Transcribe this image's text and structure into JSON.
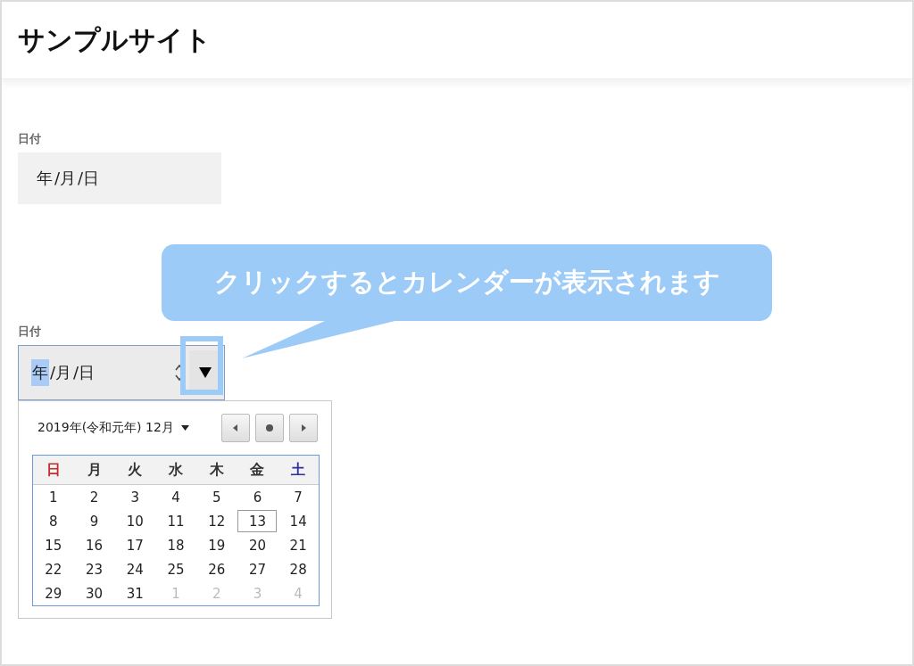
{
  "header": {
    "title": "サンプルサイト"
  },
  "fields": [
    {
      "label": "日付",
      "focused": false,
      "segments": [
        {
          "text": "年",
          "selected": false
        },
        {
          "text": "/月",
          "selected": false
        },
        {
          "text": "/日",
          "selected": false
        }
      ]
    },
    {
      "label": "日付",
      "focused": true,
      "segments": [
        {
          "text": "年",
          "selected": true
        },
        {
          "text": "/月",
          "selected": false
        },
        {
          "text": "/日",
          "selected": false
        }
      ]
    }
  ],
  "callout": {
    "text": "クリックするとカレンダーが表示されます"
  },
  "calendar": {
    "month_label": "2019年(令和元年) 12月",
    "weekdays": [
      {
        "label": "日",
        "color": "#c0302b"
      },
      {
        "label": "月",
        "color": "#333333"
      },
      {
        "label": "火",
        "color": "#333333"
      },
      {
        "label": "水",
        "color": "#333333"
      },
      {
        "label": "木",
        "color": "#333333"
      },
      {
        "label": "金",
        "color": "#333333"
      },
      {
        "label": "土",
        "color": "#2b2fa0"
      }
    ],
    "weeks": [
      [
        {
          "day": "1",
          "muted": false,
          "selected": false
        },
        {
          "day": "2",
          "muted": false,
          "selected": false
        },
        {
          "day": "3",
          "muted": false,
          "selected": false
        },
        {
          "day": "4",
          "muted": false,
          "selected": false
        },
        {
          "day": "5",
          "muted": false,
          "selected": false
        },
        {
          "day": "6",
          "muted": false,
          "selected": false
        },
        {
          "day": "7",
          "muted": false,
          "selected": false
        }
      ],
      [
        {
          "day": "8",
          "muted": false,
          "selected": false
        },
        {
          "day": "9",
          "muted": false,
          "selected": false
        },
        {
          "day": "10",
          "muted": false,
          "selected": false
        },
        {
          "day": "11",
          "muted": false,
          "selected": false
        },
        {
          "day": "12",
          "muted": false,
          "selected": false
        },
        {
          "day": "13",
          "muted": false,
          "selected": true
        },
        {
          "day": "14",
          "muted": false,
          "selected": false
        }
      ],
      [
        {
          "day": "15",
          "muted": false,
          "selected": false
        },
        {
          "day": "16",
          "muted": false,
          "selected": false
        },
        {
          "day": "17",
          "muted": false,
          "selected": false
        },
        {
          "day": "18",
          "muted": false,
          "selected": false
        },
        {
          "day": "19",
          "muted": false,
          "selected": false
        },
        {
          "day": "20",
          "muted": false,
          "selected": false
        },
        {
          "day": "21",
          "muted": false,
          "selected": false
        }
      ],
      [
        {
          "day": "22",
          "muted": false,
          "selected": false
        },
        {
          "day": "23",
          "muted": false,
          "selected": false
        },
        {
          "day": "24",
          "muted": false,
          "selected": false
        },
        {
          "day": "25",
          "muted": false,
          "selected": false
        },
        {
          "day": "26",
          "muted": false,
          "selected": false
        },
        {
          "day": "27",
          "muted": false,
          "selected": false
        },
        {
          "day": "28",
          "muted": false,
          "selected": false
        }
      ],
      [
        {
          "day": "29",
          "muted": false,
          "selected": false
        },
        {
          "day": "30",
          "muted": false,
          "selected": false
        },
        {
          "day": "31",
          "muted": false,
          "selected": false
        },
        {
          "day": "1",
          "muted": true,
          "selected": false
        },
        {
          "day": "2",
          "muted": true,
          "selected": false
        },
        {
          "day": "3",
          "muted": true,
          "selected": false
        },
        {
          "day": "4",
          "muted": true,
          "selected": false
        }
      ]
    ]
  }
}
